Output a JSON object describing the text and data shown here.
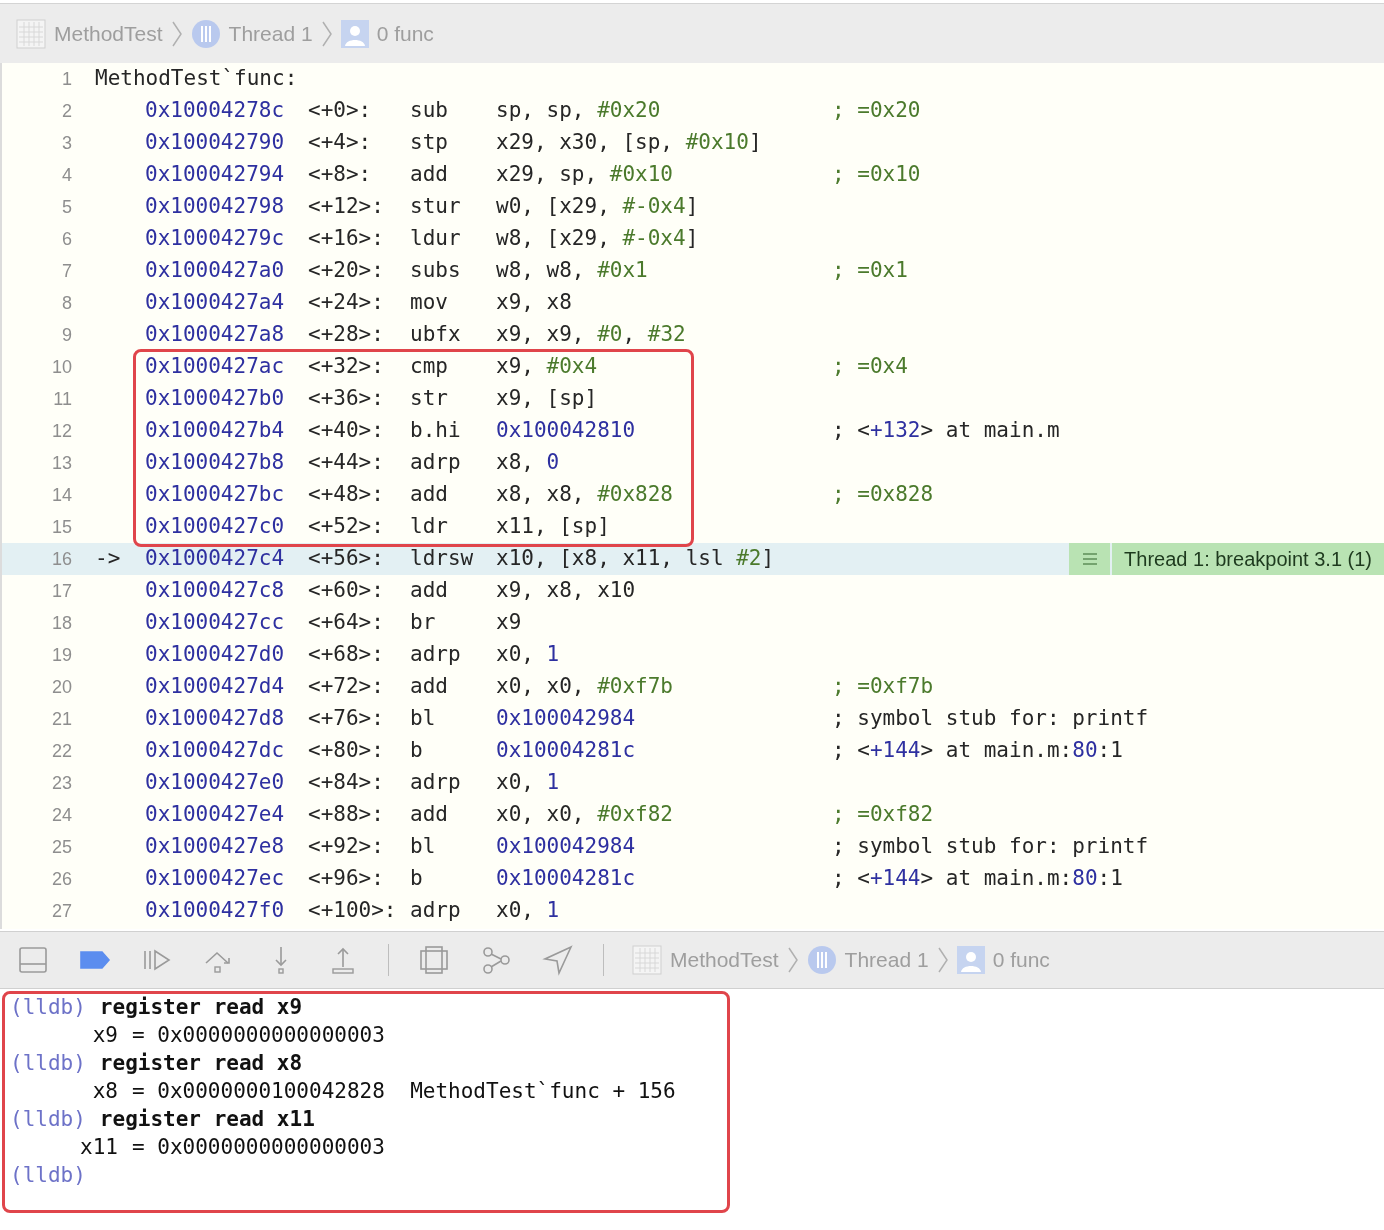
{
  "breadcrumb": [
    {
      "kind": "project",
      "label": "MethodTest"
    },
    {
      "kind": "thread",
      "label": "Thread 1"
    },
    {
      "kind": "frame",
      "label": "0 func"
    }
  ],
  "disassembly": {
    "header": {
      "number": "1",
      "text": "MethodTest`func:"
    },
    "blocks": [
      {
        "kind": "plain",
        "lines": [
          {
            "number": "2",
            "address": "0x10004278c",
            "offset": "<+0>:",
            "mnemonic": "sub",
            "operands": [
              {
                "kind": "reg",
                "text": "sp, sp, "
              },
              {
                "kind": "imm",
                "text": "#0x20"
              }
            ],
            "comment": [
              {
                "kind": "imm",
                "text": "; =0x20"
              }
            ]
          },
          {
            "number": "3",
            "address": "0x100042790",
            "offset": "<+4>:",
            "mnemonic": "stp",
            "operands": [
              {
                "kind": "reg",
                "text": "x29, x30, [sp, "
              },
              {
                "kind": "imm",
                "text": "#0x10"
              },
              {
                "kind": "reg",
                "text": "]"
              }
            ]
          },
          {
            "number": "4",
            "address": "0x100042794",
            "offset": "<+8>:",
            "mnemonic": "add",
            "operands": [
              {
                "kind": "reg",
                "text": "x29, sp, "
              },
              {
                "kind": "imm",
                "text": "#0x10"
              }
            ],
            "comment": [
              {
                "kind": "imm",
                "text": "; =0x10"
              }
            ]
          },
          {
            "number": "5",
            "address": "0x100042798",
            "offset": "<+12>:",
            "mnemonic": "stur",
            "operands": [
              {
                "kind": "reg",
                "text": "w0, [x29, "
              },
              {
                "kind": "imm",
                "text": "#-0x4"
              },
              {
                "kind": "reg",
                "text": "]"
              }
            ]
          },
          {
            "number": "6",
            "address": "0x10004279c",
            "offset": "<+16>:",
            "mnemonic": "ldur",
            "operands": [
              {
                "kind": "reg",
                "text": "w8, [x29, "
              },
              {
                "kind": "imm",
                "text": "#-0x4"
              },
              {
                "kind": "reg",
                "text": "]"
              }
            ]
          },
          {
            "number": "7",
            "address": "0x1000427a0",
            "offset": "<+20>:",
            "mnemonic": "subs",
            "operands": [
              {
                "kind": "reg",
                "text": "w8, w8, "
              },
              {
                "kind": "imm",
                "text": "#0x1"
              }
            ],
            "comment": [
              {
                "kind": "imm",
                "text": "; =0x1"
              }
            ]
          },
          {
            "number": "8",
            "address": "0x1000427a4",
            "offset": "<+24>:",
            "mnemonic": "mov",
            "operands": [
              {
                "kind": "reg",
                "text": "x9, x8"
              }
            ]
          },
          {
            "number": "9",
            "address": "0x1000427a8",
            "offset": "<+28>:",
            "mnemonic": "ubfx",
            "operands": [
              {
                "kind": "reg",
                "text": "x9, x9, "
              },
              {
                "kind": "imm",
                "text": "#0"
              },
              {
                "kind": "reg",
                "text": ", "
              },
              {
                "kind": "imm",
                "text": "#32"
              }
            ]
          }
        ]
      },
      {
        "kind": "boxed",
        "lines": [
          {
            "number": "10",
            "address": "0x1000427ac",
            "offset": "<+32>:",
            "mnemonic": "cmp",
            "operands": [
              {
                "kind": "reg",
                "text": "x9, "
              },
              {
                "kind": "imm",
                "text": "#0x4"
              }
            ],
            "comment": [
              {
                "kind": "imm",
                "text": "; =0x4"
              }
            ]
          },
          {
            "number": "11",
            "address": "0x1000427b0",
            "offset": "<+36>:",
            "mnemonic": "str",
            "operands": [
              {
                "kind": "reg",
                "text": "x9, [sp]"
              }
            ]
          },
          {
            "number": "12",
            "address": "0x1000427b4",
            "offset": "<+40>:",
            "mnemonic": "b.hi",
            "operands": [
              {
                "kind": "num",
                "text": "0x100042810"
              }
            ],
            "comment": [
              {
                "kind": "reg",
                "text": "; <"
              },
              {
                "kind": "num",
                "text": "+132"
              },
              {
                "kind": "reg",
                "text": "> at main.m"
              }
            ]
          },
          {
            "number": "13",
            "address": "0x1000427b8",
            "offset": "<+44>:",
            "mnemonic": "adrp",
            "operands": [
              {
                "kind": "reg",
                "text": "x8, "
              },
              {
                "kind": "num",
                "text": "0"
              }
            ]
          },
          {
            "number": "14",
            "address": "0x1000427bc",
            "offset": "<+48>:",
            "mnemonic": "add",
            "operands": [
              {
                "kind": "reg",
                "text": "x8, x8, "
              },
              {
                "kind": "imm",
                "text": "#0x828"
              }
            ],
            "comment": [
              {
                "kind": "imm",
                "text": "; =0x828"
              }
            ]
          },
          {
            "number": "15",
            "address": "0x1000427c0",
            "offset": "<+52>:",
            "mnemonic": "ldr",
            "operands": [
              {
                "kind": "reg",
                "text": "x11, [sp]"
              }
            ]
          }
        ]
      },
      {
        "kind": "current",
        "lines": [
          {
            "number": "16",
            "marker": "->",
            "address": "0x1000427c4",
            "offset": "<+56>:",
            "mnemonic": "ldrsw",
            "operands": [
              {
                "kind": "reg",
                "text": "x10, [x8, x11, lsl "
              },
              {
                "kind": "imm",
                "text": "#2"
              },
              {
                "kind": "reg",
                "text": "]"
              }
            ],
            "annotation": "Thread 1: breakpoint 3.1 (1)"
          }
        ]
      },
      {
        "kind": "plain",
        "lines": [
          {
            "number": "17",
            "address": "0x1000427c8",
            "offset": "<+60>:",
            "mnemonic": "add",
            "operands": [
              {
                "kind": "reg",
                "text": "x9, x8, x10"
              }
            ]
          },
          {
            "number": "18",
            "address": "0x1000427cc",
            "offset": "<+64>:",
            "mnemonic": "br",
            "operands": [
              {
                "kind": "reg",
                "text": "x9"
              }
            ]
          },
          {
            "number": "19",
            "address": "0x1000427d0",
            "offset": "<+68>:",
            "mnemonic": "adrp",
            "operands": [
              {
                "kind": "reg",
                "text": "x0, "
              },
              {
                "kind": "num",
                "text": "1"
              }
            ]
          },
          {
            "number": "20",
            "address": "0x1000427d4",
            "offset": "<+72>:",
            "mnemonic": "add",
            "operands": [
              {
                "kind": "reg",
                "text": "x0, x0, "
              },
              {
                "kind": "imm",
                "text": "#0xf7b"
              }
            ],
            "comment": [
              {
                "kind": "imm",
                "text": "; =0xf7b"
              }
            ]
          },
          {
            "number": "21",
            "address": "0x1000427d8",
            "offset": "<+76>:",
            "mnemonic": "bl",
            "operands": [
              {
                "kind": "num",
                "text": "0x100042984"
              }
            ],
            "comment": [
              {
                "kind": "reg",
                "text": "; symbol stub for: printf"
              }
            ]
          },
          {
            "number": "22",
            "address": "0x1000427dc",
            "offset": "<+80>:",
            "mnemonic": "b",
            "operands": [
              {
                "kind": "num",
                "text": "0x10004281c"
              }
            ],
            "comment": [
              {
                "kind": "reg",
                "text": "; <"
              },
              {
                "kind": "num",
                "text": "+144"
              },
              {
                "kind": "reg",
                "text": "> at main.m:"
              },
              {
                "kind": "num",
                "text": "80"
              },
              {
                "kind": "reg",
                "text": ":1"
              }
            ]
          },
          {
            "number": "23",
            "address": "0x1000427e0",
            "offset": "<+84>:",
            "mnemonic": "adrp",
            "operands": [
              {
                "kind": "reg",
                "text": "x0, "
              },
              {
                "kind": "num",
                "text": "1"
              }
            ]
          },
          {
            "number": "24",
            "address": "0x1000427e4",
            "offset": "<+88>:",
            "mnemonic": "add",
            "operands": [
              {
                "kind": "reg",
                "text": "x0, x0, "
              },
              {
                "kind": "imm",
                "text": "#0xf82"
              }
            ],
            "comment": [
              {
                "kind": "imm",
                "text": "; =0xf82"
              }
            ]
          },
          {
            "number": "25",
            "address": "0x1000427e8",
            "offset": "<+92>:",
            "mnemonic": "bl",
            "operands": [
              {
                "kind": "num",
                "text": "0x100042984"
              }
            ],
            "comment": [
              {
                "kind": "reg",
                "text": "; symbol stub for: printf"
              }
            ]
          },
          {
            "number": "26",
            "address": "0x1000427ec",
            "offset": "<+96>:",
            "mnemonic": "b",
            "operands": [
              {
                "kind": "num",
                "text": "0x10004281c"
              }
            ],
            "comment": [
              {
                "kind": "reg",
                "text": "; <"
              },
              {
                "kind": "num",
                "text": "+144"
              },
              {
                "kind": "reg",
                "text": "> at main.m:"
              },
              {
                "kind": "num",
                "text": "80"
              },
              {
                "kind": "reg",
                "text": ":1"
              }
            ]
          },
          {
            "number": "27",
            "address": "0x1000427f0",
            "offset": "<+100>:",
            "mnemonic": "adrp",
            "operands": [
              {
                "kind": "reg",
                "text": "x0, "
              },
              {
                "kind": "num",
                "text": "1"
              }
            ]
          }
        ]
      }
    ]
  },
  "debug_bar": {
    "buttons": [
      {
        "kind": "toggle-console",
        "active": false
      },
      {
        "kind": "breakpoints",
        "active": true
      },
      {
        "kind": "continue",
        "active": false
      },
      {
        "kind": "step-over",
        "active": false
      },
      {
        "kind": "step-into",
        "active": false
      },
      {
        "kind": "step-out",
        "active": false
      },
      {
        "kind": "view-debugger",
        "active": false
      },
      {
        "kind": "memory-graph",
        "active": false
      },
      {
        "kind": "location",
        "active": false
      }
    ],
    "breadcrumb": [
      {
        "kind": "project",
        "label": "MethodTest"
      },
      {
        "kind": "thread",
        "label": "Thread 1"
      },
      {
        "kind": "frame",
        "label": "0 func"
      }
    ]
  },
  "console": {
    "boxed": true,
    "lines": [
      {
        "kind": "prompt",
        "prompt": "(lldb)",
        "command": "register read x9"
      },
      {
        "kind": "output",
        "register": "x9",
        "value": "= 0x0000000000000003"
      },
      {
        "kind": "prompt",
        "prompt": "(lldb)",
        "command": "register read x8"
      },
      {
        "kind": "output",
        "register": "x8",
        "value": "= 0x0000000100042828  MethodTest`func + 156"
      },
      {
        "kind": "prompt",
        "prompt": "(lldb)",
        "command": "register read x11"
      },
      {
        "kind": "output",
        "register": "x11",
        "value": "= 0x0000000000000003"
      },
      {
        "kind": "prompt",
        "prompt": "(lldb)"
      }
    ]
  }
}
